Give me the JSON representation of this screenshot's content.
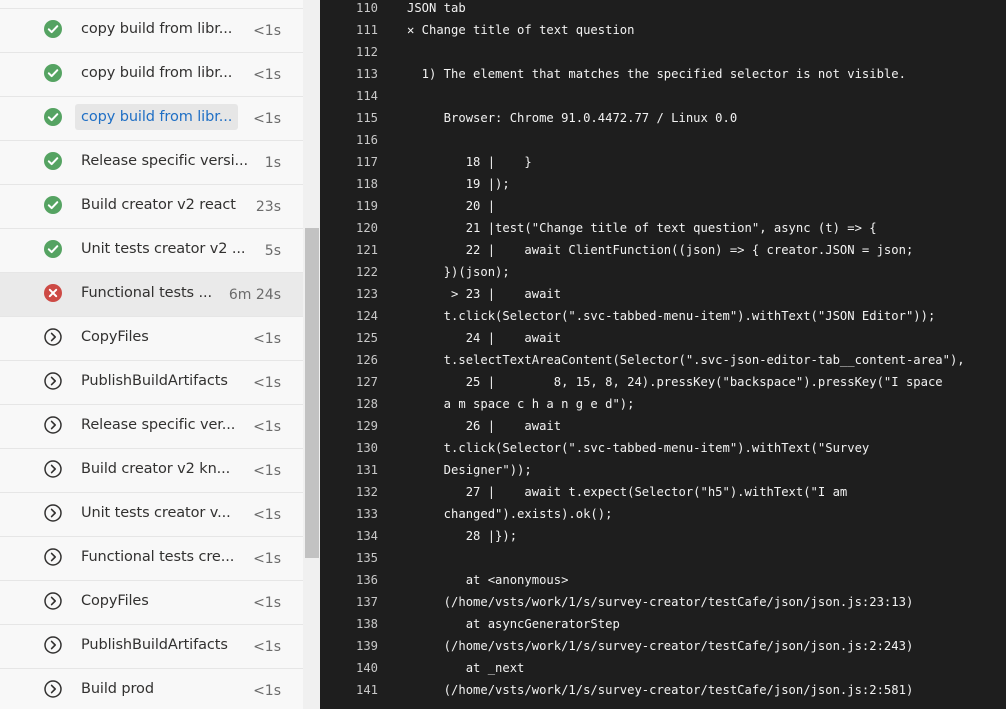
{
  "steps": [
    {
      "name": "copy build from libr...",
      "duration": "<1s",
      "status": "success",
      "icon": "check-circle-icon"
    },
    {
      "name": "copy build from libr...",
      "duration": "<1s",
      "status": "success",
      "icon": "check-circle-icon"
    },
    {
      "name": "copy build from libr...",
      "duration": "<1s",
      "status": "success",
      "icon": "check-circle-icon",
      "selected": true
    },
    {
      "name": "Release specific versi...",
      "duration": "1s",
      "status": "success",
      "icon": "check-circle-icon"
    },
    {
      "name": "Build creator v2 react",
      "duration": "23s",
      "status": "success",
      "icon": "check-circle-icon"
    },
    {
      "name": "Unit tests creator v2 ...",
      "duration": "5s",
      "status": "success",
      "icon": "check-circle-icon"
    },
    {
      "name": "Functional tests ...",
      "duration": "6m 24s",
      "status": "failed",
      "icon": "error-circle-icon",
      "active": true
    },
    {
      "name": "CopyFiles",
      "duration": "<1s",
      "status": "pending",
      "icon": "chevron-circle-icon"
    },
    {
      "name": "PublishBuildArtifacts",
      "duration": "<1s",
      "status": "pending",
      "icon": "chevron-circle-icon"
    },
    {
      "name": "Release specific ver...",
      "duration": "<1s",
      "status": "pending",
      "icon": "chevron-circle-icon"
    },
    {
      "name": "Build creator v2 kn...",
      "duration": "<1s",
      "status": "pending",
      "icon": "chevron-circle-icon"
    },
    {
      "name": "Unit tests creator v...",
      "duration": "<1s",
      "status": "pending",
      "icon": "chevron-circle-icon"
    },
    {
      "name": "Functional tests cre...",
      "duration": "<1s",
      "status": "pending",
      "icon": "chevron-circle-icon"
    },
    {
      "name": "CopyFiles",
      "duration": "<1s",
      "status": "pending",
      "icon": "chevron-circle-icon"
    },
    {
      "name": "PublishBuildArtifacts",
      "duration": "<1s",
      "status": "pending",
      "icon": "chevron-circle-icon"
    },
    {
      "name": "Build prod",
      "duration": "<1s",
      "status": "pending",
      "icon": "chevron-circle-icon"
    }
  ],
  "colors": {
    "success": "#55a362",
    "failed": "#cd4a45",
    "pending": "#323130",
    "log_bg": "#1e1e1e",
    "link": "#1f6fc5"
  },
  "log": [
    {
      "num": "110",
      "text": "JSON tab"
    },
    {
      "num": "111",
      "text": "✕ Change title of text question"
    },
    {
      "num": "112",
      "text": ""
    },
    {
      "num": "113",
      "text": "  1) The element that matches the specified selector is not visible."
    },
    {
      "num": "114",
      "text": ""
    },
    {
      "num": "115",
      "text": "     Browser: Chrome 91.0.4472.77 / Linux 0.0"
    },
    {
      "num": "116",
      "text": ""
    },
    {
      "num": "117",
      "text": "        18 |    }"
    },
    {
      "num": "118",
      "text": "        19 |);"
    },
    {
      "num": "119",
      "text": "        20 |"
    },
    {
      "num": "120",
      "text": "        21 |test(\"Change title of text question\", async (t) => {"
    },
    {
      "num": "121",
      "text": "        22 |    await ClientFunction((json) => { creator.JSON = json;"
    },
    {
      "num": "122",
      "text": "     })(json);"
    },
    {
      "num": "123",
      "text": "      > 23 |    await"
    },
    {
      "num": "124",
      "text": "     t.click(Selector(\".svc-tabbed-menu-item\").withText(\"JSON Editor\"));"
    },
    {
      "num": "125",
      "text": "        24 |    await"
    },
    {
      "num": "126",
      "text": "     t.selectTextAreaContent(Selector(\".svc-json-editor-tab__content-area\"),"
    },
    {
      "num": "127",
      "text": "        25 |        8, 15, 8, 24).pressKey(\"backspace\").pressKey(\"I space"
    },
    {
      "num": "128",
      "text": "     a m space c h a n g e d\");"
    },
    {
      "num": "129",
      "text": "        26 |    await"
    },
    {
      "num": "130",
      "text": "     t.click(Selector(\".svc-tabbed-menu-item\").withText(\"Survey"
    },
    {
      "num": "131",
      "text": "     Designer\"));"
    },
    {
      "num": "132",
      "text": "        27 |    await t.expect(Selector(\"h5\").withText(\"I am"
    },
    {
      "num": "133",
      "text": "     changed\").exists).ok();"
    },
    {
      "num": "134",
      "text": "        28 |});"
    },
    {
      "num": "135",
      "text": ""
    },
    {
      "num": "136",
      "text": "        at <anonymous>"
    },
    {
      "num": "137",
      "text": "     (/home/vsts/work/1/s/survey-creator/testCafe/json/json.js:23:13)"
    },
    {
      "num": "138",
      "text": "        at asyncGeneratorStep"
    },
    {
      "num": "139",
      "text": "     (/home/vsts/work/1/s/survey-creator/testCafe/json/json.js:2:243)"
    },
    {
      "num": "140",
      "text": "        at _next"
    },
    {
      "num": "141",
      "text": "     (/home/vsts/work/1/s/survey-creator/testCafe/json/json.js:2:581)"
    }
  ]
}
